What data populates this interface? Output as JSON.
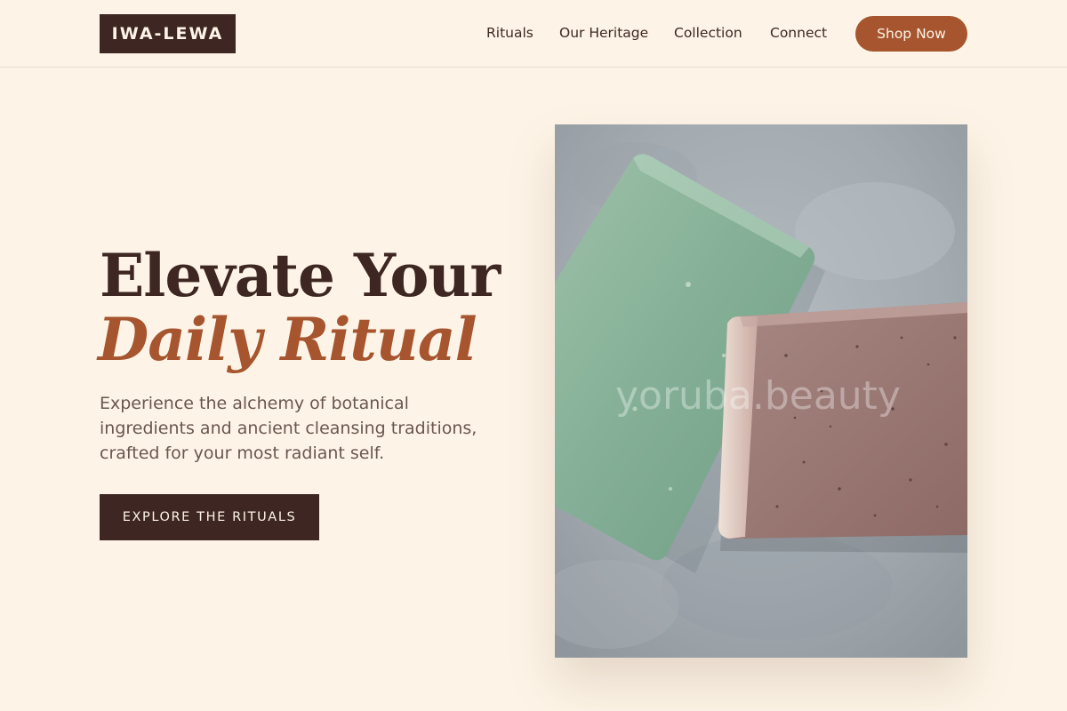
{
  "header": {
    "logo_text": "IWA-LEWA",
    "nav": [
      "Rituals",
      "Our Heritage",
      "Collection",
      "Connect"
    ],
    "cta_label": "Shop Now"
  },
  "hero": {
    "title_line1": "Elevate Your",
    "title_line2": "Daily Ritual",
    "description": "Experience the alchemy of botanical ingredients and ancient cleansing traditions, crafted for your most radiant self.",
    "button_label": "EXPLORE THE RITUALS",
    "image_watermark": "yoruba.beauty"
  },
  "colors": {
    "background": "#fdf4e7",
    "dark_brown": "#3e2722",
    "accent_rust": "#a6552f",
    "body_text": "#6a5650"
  }
}
